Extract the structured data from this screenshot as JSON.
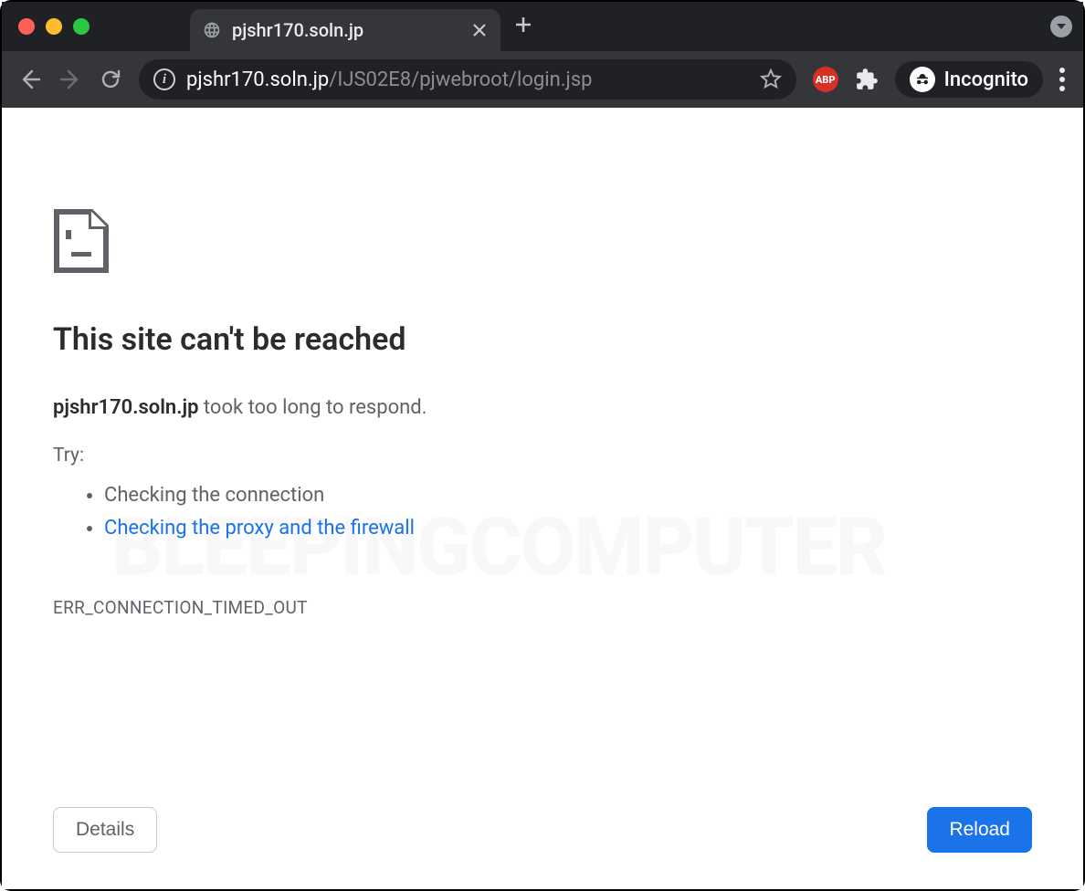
{
  "browser": {
    "tab_title": "pjshr170.soln.jp",
    "url_host": "pjshr170.soln.jp",
    "url_path": "/IJS02E8/pjwebroot/login.jsp",
    "incognito_label": "Incognito",
    "extensions": {
      "abp_label": "ABP"
    }
  },
  "error": {
    "title": "This site can't be reached",
    "host_bold": "pjshr170.soln.jp",
    "host_suffix": " took too long to respond.",
    "try_label": "Try:",
    "suggestions": {
      "check_connection": "Checking the connection",
      "check_proxy_firewall": "Checking the proxy and the firewall"
    },
    "code": "ERR_CONNECTION_TIMED_OUT",
    "buttons": {
      "details": "Details",
      "reload": "Reload"
    }
  },
  "watermark": "BLEEPINGCOMPUTER"
}
